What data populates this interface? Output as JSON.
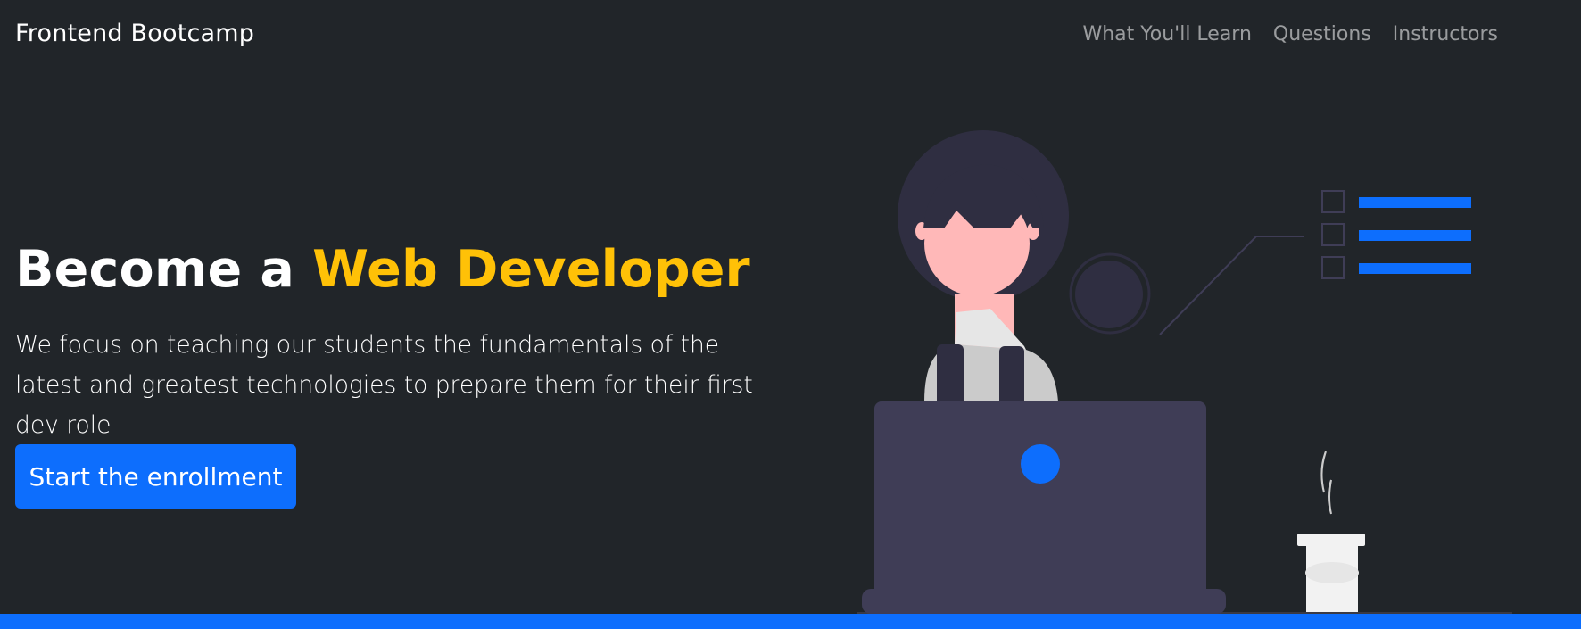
{
  "navbar": {
    "brand": "Frontend Bootcamp",
    "links": [
      {
        "label": "What You'll Learn"
      },
      {
        "label": "Questions"
      },
      {
        "label": "Instructors"
      }
    ]
  },
  "hero": {
    "title_prefix": "Become a ",
    "title_accent": "Web Developer",
    "lead": "We focus on teaching our students the fundamentals of the latest and greatest technologies to prepare them for their first dev role",
    "cta_label": "Start the enrollment"
  },
  "illustration": {
    "icon": "woman-at-laptop-illustration"
  },
  "colors": {
    "background": "#212529",
    "accent": "#ffc107",
    "primary": "#0d6efd",
    "laptop": "#3f3d56",
    "hair": "#2f2e41",
    "skin": "#ffb8b8",
    "shirt": "#cbcbcb"
  }
}
